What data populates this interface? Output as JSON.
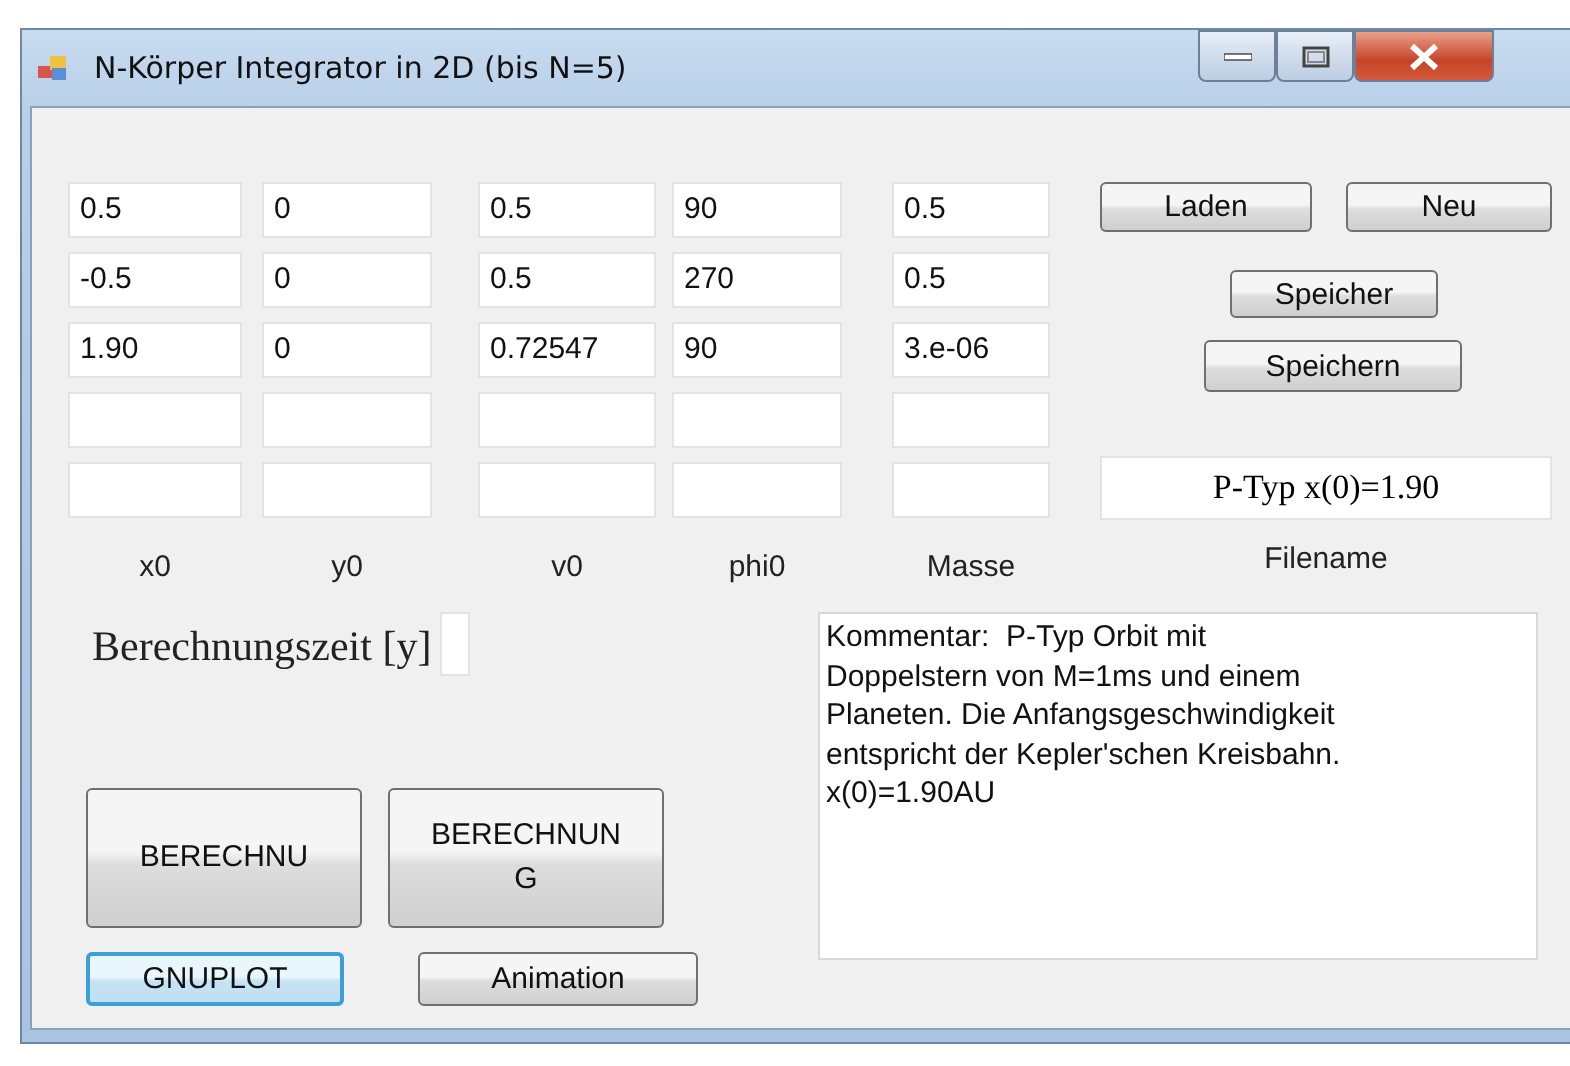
{
  "window": {
    "title": "N-Körper Integrator in 2D (bis N=5)"
  },
  "columns": [
    {
      "label": "x0",
      "cells": [
        {
          "value": "0.5"
        },
        {
          "value": "-0.5"
        },
        {
          "value": "1.90"
        },
        {},
        {}
      ]
    },
    {
      "label": "y0",
      "cells": [
        {
          "value": "0"
        },
        {
          "value": "0"
        },
        {
          "value": "0"
        },
        {},
        {}
      ]
    },
    {
      "label": "v0",
      "cells": [
        {
          "value": "0.5"
        },
        {
          "value": "0.5"
        },
        {
          "value": "0.72547"
        },
        {},
        {}
      ]
    },
    {
      "label": "phi0",
      "cells": [
        {
          "value": "90"
        },
        {
          "value": "270"
        },
        {
          "value": "90"
        },
        {},
        {}
      ]
    },
    {
      "label": "Masse",
      "cells": [
        {
          "value": "0.5"
        },
        {
          "value": "0.5"
        },
        {
          "value": "3.e-06"
        },
        {},
        {}
      ]
    }
  ],
  "file_buttons": {
    "load": "Laden",
    "new": "Neu",
    "store": "Speicher",
    "save": "Speichern"
  },
  "filename": {
    "value": "P-Typ x(0)=1.90",
    "label": "Filename"
  },
  "calc_time": {
    "label": "Berechnungszeit [y]"
  },
  "comment": "Kommentar:  P-Typ Orbit mit\nDoppelstern von M=1ms und einem\nPlaneten. Die Anfangsgeschwindigkeit\nentspricht der Kepler'schen Kreisbahn.\nx(0)=1.90AU",
  "buttons": [
    {
      "label": "BERECHNU",
      "kind": "large",
      "focused": false
    },
    {
      "label": "BERECHNUN\nG",
      "kind": "large",
      "focused": false
    },
    {
      "label": "GNUPLOT",
      "kind": "small",
      "focused": true
    },
    {
      "label": "Animation",
      "kind": "small",
      "focused": false
    }
  ]
}
